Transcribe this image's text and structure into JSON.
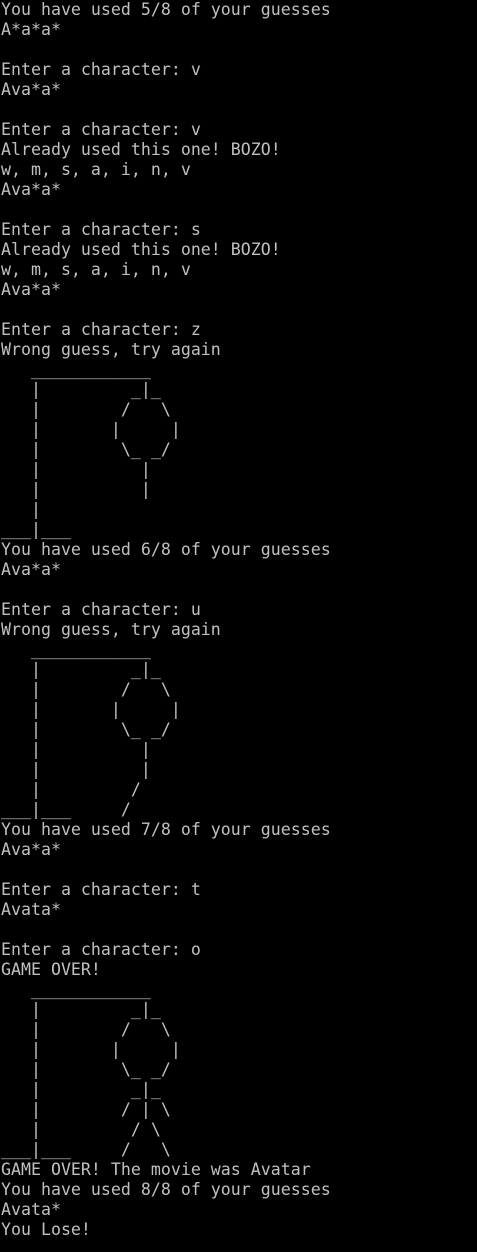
{
  "terminal": {
    "colors": {
      "background": "#000000",
      "text": "#c0c0c0"
    },
    "lines": [
      "You have used 5/8 of your guesses",
      "A*a*a*",
      "",
      "Enter a character: v",
      "Ava*a*",
      "",
      "Enter a character: v",
      "Already used this one! BOZO!",
      "w, m, s, a, i, n, v",
      "Ava*a*",
      "",
      "Enter a character: s",
      "Already used this one! BOZO!",
      "w, m, s, a, i, n, v",
      "Ava*a*",
      "",
      "Enter a character: z",
      "Wrong guess, try again",
      "   ____________",
      "   |         _|_",
      "   |        /   \\",
      "   |       |     |",
      "   |        \\_ _/",
      "   |          |",
      "   |          |",
      "   |",
      "___|___",
      "You have used 6/8 of your guesses",
      "Ava*a*",
      "",
      "Enter a character: u",
      "Wrong guess, try again",
      "   ____________",
      "   |         _|_",
      "   |        /   \\",
      "   |       |     |",
      "   |        \\_ _/",
      "   |          |",
      "   |          |",
      "   |         /",
      "___|___     /",
      "You have used 7/8 of your guesses",
      "Ava*a*",
      "",
      "Enter a character: t",
      "Avata*",
      "",
      "Enter a character: o",
      "GAME OVER!",
      "   ____________",
      "   |         _|_",
      "   |        /   \\",
      "   |       |     |",
      "   |        \\_ _/",
      "   |         _|_",
      "   |        / | \\",
      "   |         / \\",
      "___|___     /   \\",
      "GAME OVER! The movie was Avatar",
      "You have used 8/8 of your guesses",
      "Avata*",
      "You Lose!"
    ]
  }
}
